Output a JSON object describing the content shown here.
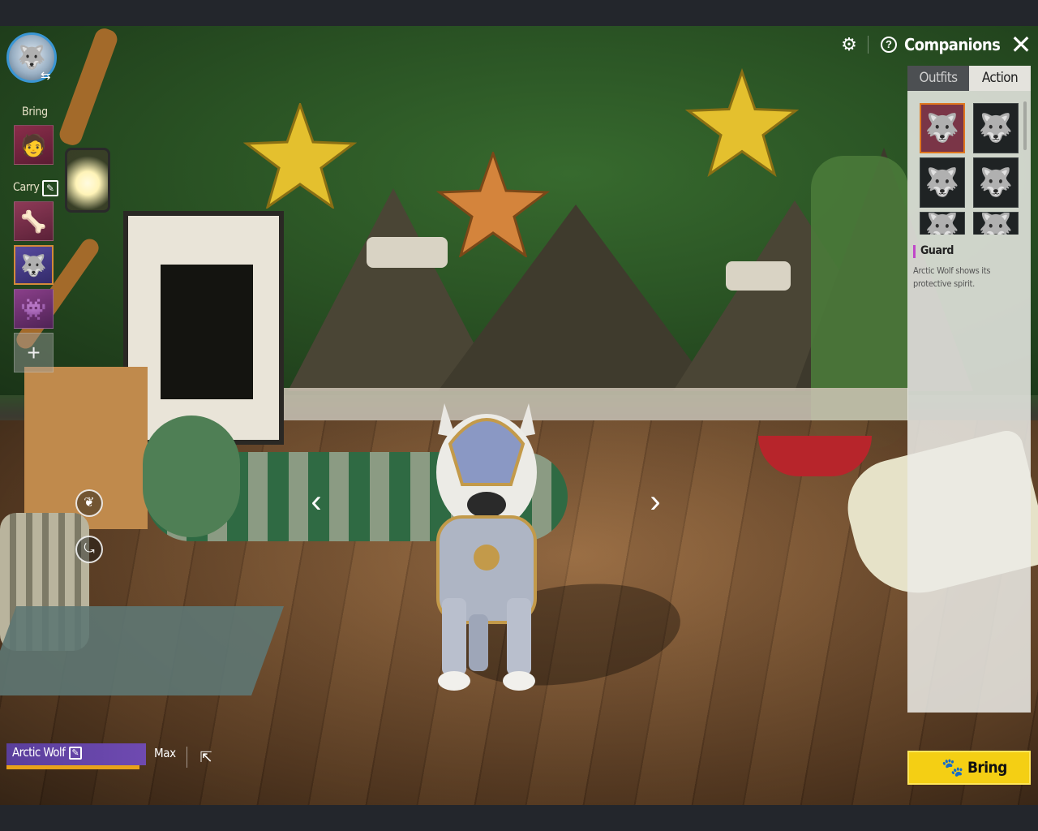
{
  "header": {
    "title": "Companions",
    "settings_icon": "gear-icon",
    "help_icon": "question-icon",
    "close_icon": "close-icon"
  },
  "left_panel": {
    "avatar_icon": "wolf-portrait-icon",
    "swap_icon": "swap-icon",
    "bring_label": "Bring",
    "carry_label": "Carry",
    "carry_edit_icon": "edit-icon",
    "add_label": "+",
    "action_buttons": [
      {
        "icon": "pose-icon"
      },
      {
        "icon": "rotate-icon"
      }
    ]
  },
  "tabs": [
    {
      "label": "Outfits",
      "active": false
    },
    {
      "label": "Action",
      "active": true
    }
  ],
  "actions": [
    {
      "icon": "wolf-guard-icon",
      "selected": true
    },
    {
      "icon": "wolf-standing-icon",
      "selected": false
    },
    {
      "icon": "wolf-howl-icon",
      "selected": false
    },
    {
      "icon": "wolf-attack-icon",
      "selected": false
    },
    {
      "icon": "wolf-lie-icon",
      "selected": false
    },
    {
      "icon": "wolf-sit-icon",
      "selected": false
    }
  ],
  "selected_action": {
    "title": "Guard",
    "description": "Arctic Wolf shows its protective spirit."
  },
  "companion": {
    "name": "Arctic Wolf",
    "level": "Max",
    "edit_icon": "edit-icon",
    "share_icon": "share-icon"
  },
  "navigation": {
    "prev": "‹",
    "next": "›"
  },
  "bring_button": {
    "label": "Bring",
    "icon": "paw-icon"
  },
  "colors": {
    "accent_yellow": "#f4cf14",
    "name_bar": "#6f4ab1",
    "selected_border": "#e0771f",
    "desc_marker": "#c046c9"
  }
}
